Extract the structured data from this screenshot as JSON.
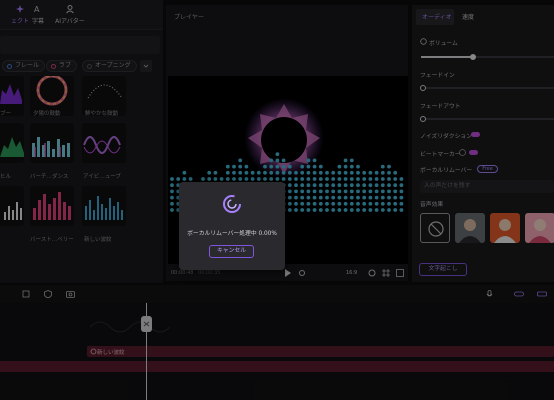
{
  "top_tools": [
    {
      "label": "ェクト",
      "icon": "effects-icon",
      "active": true
    },
    {
      "label": "字幕",
      "icon": "captions-icon",
      "active": false
    },
    {
      "label": "AIアバター",
      "icon": "ai-avatar-icon",
      "active": false
    }
  ],
  "filter_chips": [
    {
      "label": "フレール"
    },
    {
      "label": "ラブ"
    },
    {
      "label": "オープニング"
    }
  ],
  "thumbnails_row1": [
    "ブー",
    "夕陽の鼓動",
    "鮮やかな鼓動"
  ],
  "thumbnails_row2": [
    "ヒル",
    "バーチ…ダンス",
    "アイビ…ューブ"
  ],
  "thumbnails_row3": [
    "",
    "バースト…ベリー",
    "新しい波紋"
  ],
  "player": {
    "title": "プレイヤー",
    "time": "00:00:48",
    "total": "00:00:35",
    "ratio": "16:9"
  },
  "dialog": {
    "text": "ボーカルリムーバー処理中 0.00%",
    "cancel": "キャンセル"
  },
  "right_panel": {
    "tab_audio": "オーディオ",
    "tab_speed": "速度",
    "volume_label": "ボリューム",
    "volume_fraction": 0.39,
    "fade_in_label": "フェードイン",
    "fade_out_label": "フェードアウト",
    "noise_label": "ノイズリダクション",
    "beat_label": "ビートマーカー",
    "vocal_label": "ボーカルリムーバー",
    "vocal_badge": "Free",
    "voice_placeholder": "人の声だけを残す",
    "voice_section": "音声効果",
    "convert_button": "文字起こし"
  },
  "timeline": {
    "clip_label": "新しい波紋"
  },
  "colors": {
    "accent": "#a780ff",
    "clip": "#5b1e2e",
    "toggle": "#c050e0"
  }
}
